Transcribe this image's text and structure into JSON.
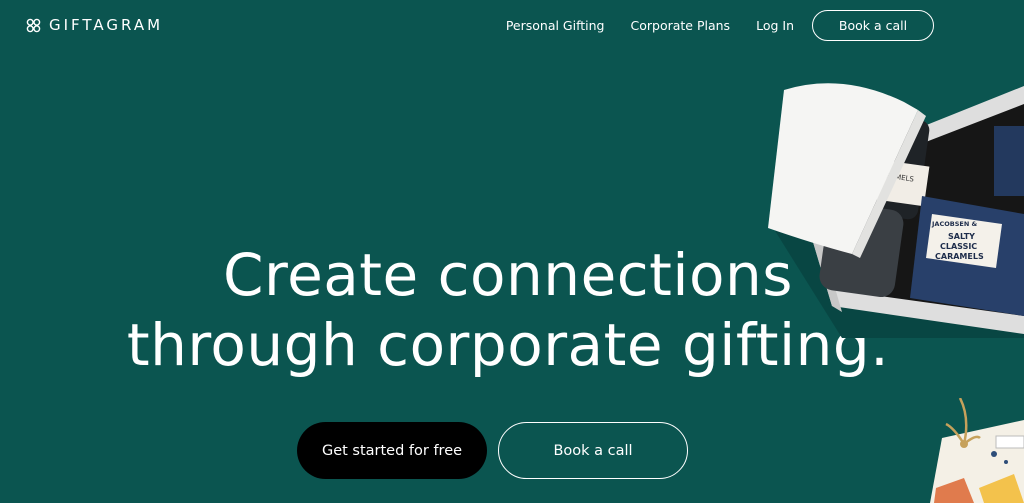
{
  "header": {
    "logo_text": "GIFTAGRAM",
    "logo_icon": "giftagram-flower-icon",
    "nav": {
      "personal_gifting": "Personal Gifting",
      "corporate_plans": "Corporate Plans",
      "log_in": "Log In",
      "book_call": "Book a call"
    }
  },
  "hero": {
    "title_line1": "Create connections",
    "title_line2": "through corporate gifting.",
    "cta_primary": "Get started for free",
    "cta_secondary": "Book a call"
  },
  "product_image": {
    "jar_label": "ALTY CARAMELS",
    "bag_brand": "JACOBSEN &",
    "bag_line1": "SALTY",
    "bag_line2": "CLASSIC",
    "bag_line3": "CARAMELS"
  },
  "colors": {
    "background": "#0b5550",
    "primary_button": "#000000",
    "text": "#ffffff"
  }
}
